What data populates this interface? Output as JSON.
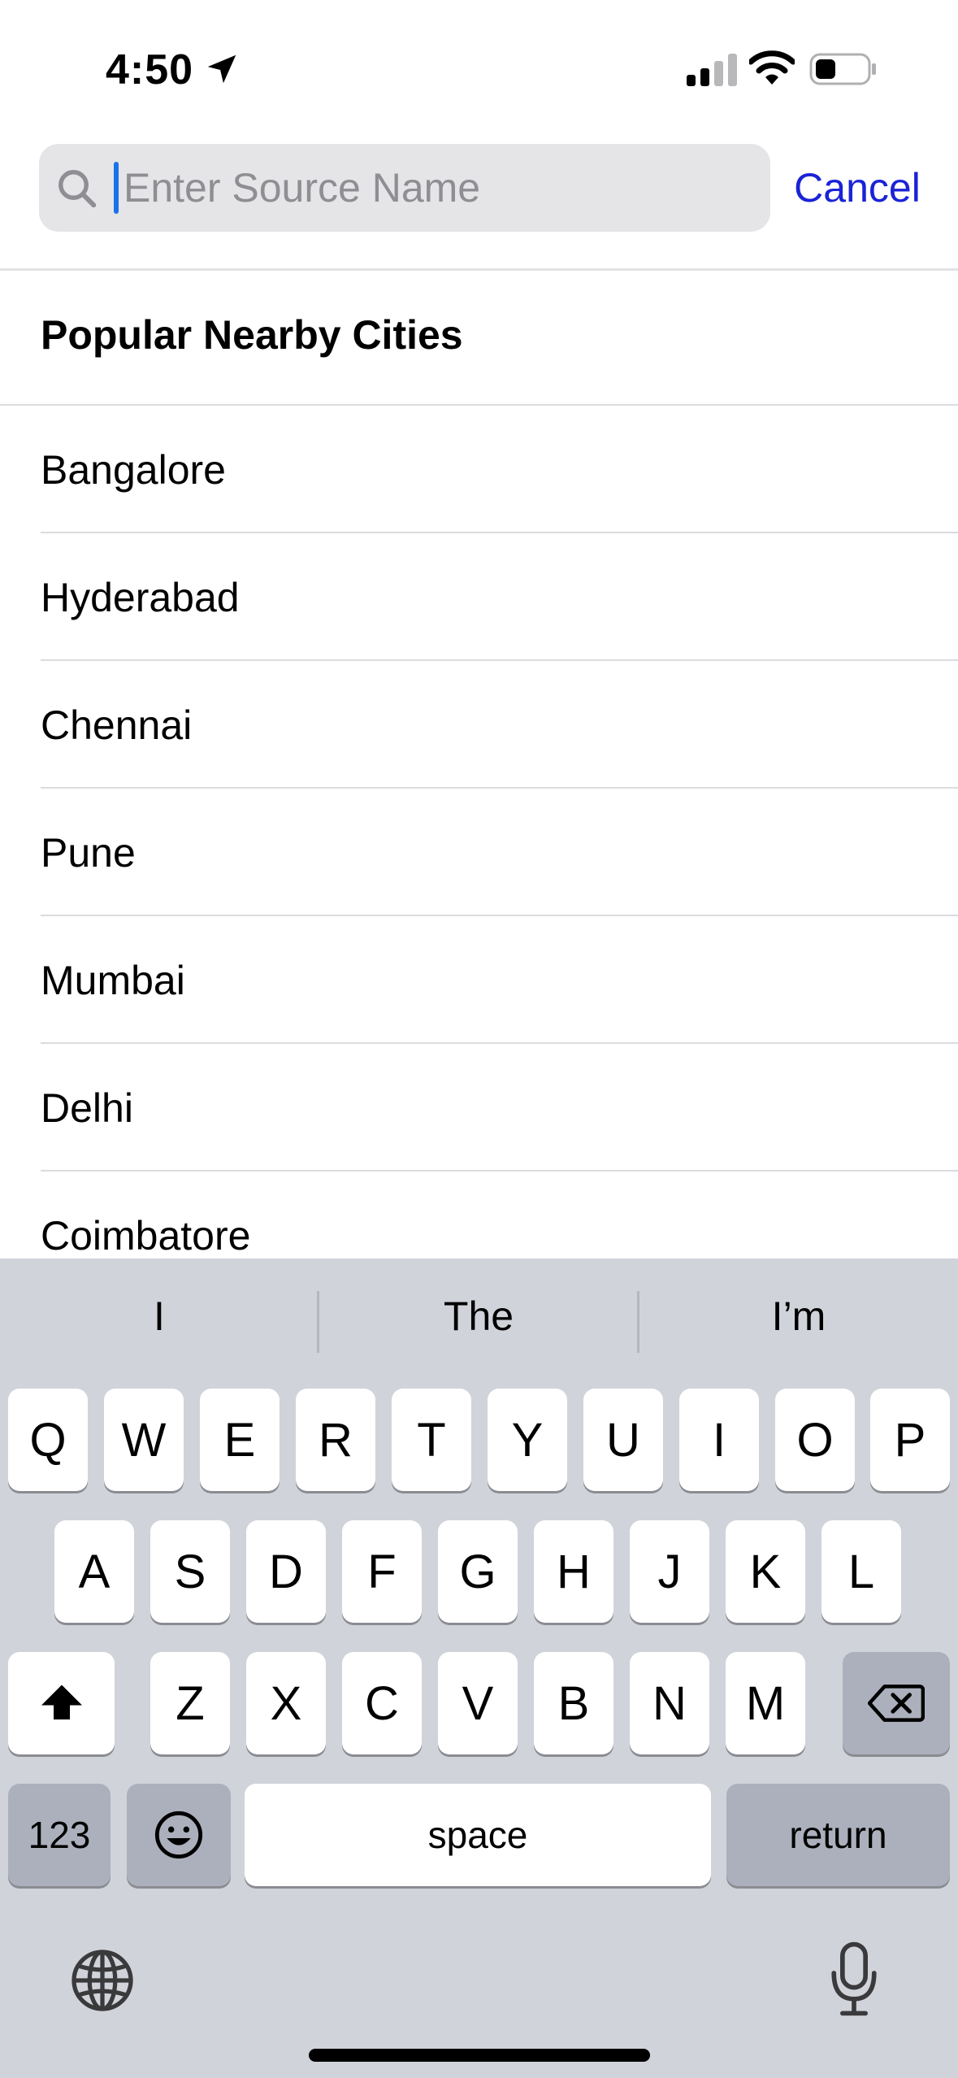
{
  "status_bar": {
    "time": "4:50",
    "icons": [
      "location-arrow-icon",
      "cellular-signal-icon",
      "wifi-icon",
      "battery-icon"
    ]
  },
  "search": {
    "placeholder": "Enter Source Name",
    "value": "",
    "cancel_label": "Cancel",
    "accent_color": "#1a23d6"
  },
  "list": {
    "section_title": "Popular Nearby Cities",
    "cities": [
      "Bangalore",
      "Hyderabad",
      "Chennai",
      "Pune",
      "Mumbai",
      "Delhi",
      "Coimbatore"
    ]
  },
  "keyboard": {
    "suggestions": [
      "I",
      "The",
      "I’m"
    ],
    "row1": [
      "Q",
      "W",
      "E",
      "R",
      "T",
      "Y",
      "U",
      "I",
      "O",
      "P"
    ],
    "row2": [
      "A",
      "S",
      "D",
      "F",
      "G",
      "H",
      "J",
      "K",
      "L"
    ],
    "row3": [
      "Z",
      "X",
      "C",
      "V",
      "B",
      "N",
      "M"
    ],
    "numbers_label": "123",
    "space_label": "space",
    "return_label": "return",
    "icons": [
      "shift-icon",
      "backspace-icon",
      "emoji-icon",
      "globe-icon",
      "microphone-icon"
    ]
  }
}
